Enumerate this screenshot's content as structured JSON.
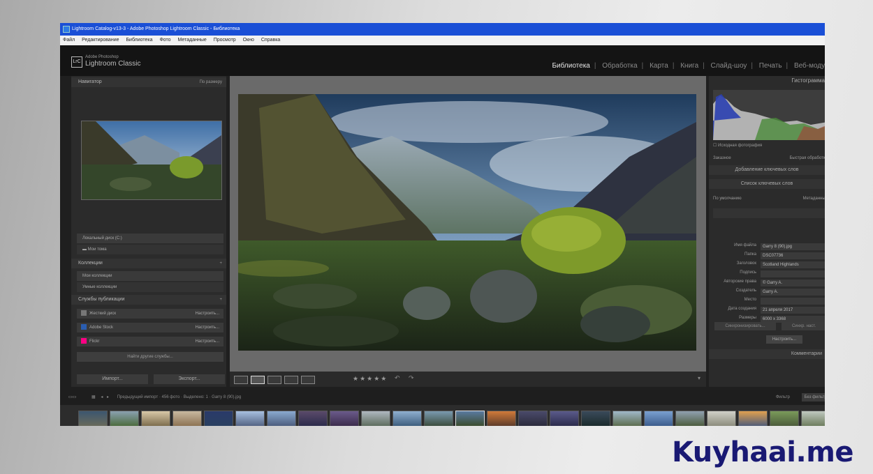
{
  "window": {
    "title": "Lightroom Catalog-v13-3 - Adobe Photoshop Lightroom Classic - Библиотека"
  },
  "menu": [
    "Файл",
    "Редактирование",
    "Библиотека",
    "Фото",
    "Метаданные",
    "Просмотр",
    "Окно",
    "Справка"
  ],
  "header": {
    "logo_glyph": "LrC",
    "brand_small": "Adobe Photoshop",
    "brand_big": "Lightroom Classic",
    "modules": [
      "Библиотека",
      "Обработка",
      "Карта",
      "Книга",
      "Слайд-шоу",
      "Печать",
      "Веб-модуль"
    ],
    "active_module": "Библиотека"
  },
  "left_panel": {
    "navigator_label": "Навигатор",
    "navigator_zoom": "По размеру",
    "collections_label": "Коллекции",
    "collection_set": "Мои коллекции",
    "smart_collection": "Умные коллекции",
    "publish_label": "Службы публикации",
    "folder_row": "Локальный диск (C:)",
    "folder_sub": "Мои тома",
    "services": [
      {
        "name": "Жесткий диск",
        "action": "Настроить...",
        "color": "#777777"
      },
      {
        "name": "Adobe Stock",
        "action": "Настроить...",
        "color": "#2a5db0"
      },
      {
        "name": "Flickr",
        "action": "Настроить...",
        "color": "#ff0084"
      }
    ],
    "find_more": "Найти другие службы...",
    "import_btn": "Импорт...",
    "export_btn": "Экспорт..."
  },
  "right_panel": {
    "histogram_title": "Гистограмма",
    "original_photo": "Исходная фотография",
    "saved_preset": "Заказное",
    "quick_develop": "Быстрая обработка",
    "keywording": "Добавление ключевых слов",
    "keyword_list": "Список ключевых слов",
    "metadata_preset": "По умолчанию",
    "metadata_title": "Метаданные",
    "metadata": [
      {
        "k": "Имя файла",
        "v": "Garry 8 (90).jpg"
      },
      {
        "k": "Папка",
        "v": "DSC07736"
      },
      {
        "k": "Заголовок",
        "v": "Scotland Highlands"
      },
      {
        "k": "Подпись",
        "v": ""
      },
      {
        "k": "Авторские права",
        "v": "© Garry A."
      },
      {
        "k": "Создатель",
        "v": "Garry A."
      },
      {
        "k": "Место",
        "v": ""
      },
      {
        "k": "Дата создания",
        "v": "21 апреля 2017"
      },
      {
        "k": "Размеры",
        "v": "6000 x 3368"
      }
    ],
    "customize": "Настроить...",
    "comments": "Комментарии",
    "sync_btn": "Синхронизировать...",
    "sync_settings": "Синхр. наст."
  },
  "toolbar": {
    "stars": "★★★★★"
  },
  "filmstrip": {
    "path": "Предыдущий импорт · 456 фото · Выделено: 1 · Garry 8 (90).jpg",
    "filter_label": "Фильтр",
    "filter_value": "Без фильтра"
  },
  "watermark": "Kuyhaai.me",
  "colors": {
    "title_blue": "#1a4fd6",
    "watermark": "#191973"
  }
}
